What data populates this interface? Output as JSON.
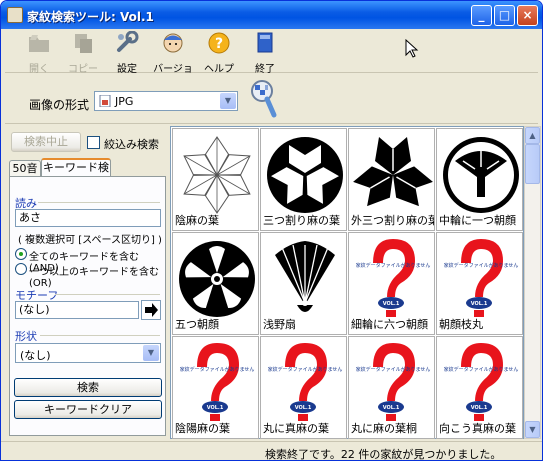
{
  "window": {
    "title": "家紋検索ツール: Vol.1",
    "controls": [
      "_",
      "□",
      "×"
    ]
  },
  "toolbar": [
    {
      "label": "開く",
      "icon": "folder-icon",
      "enabled": false
    },
    {
      "label": "コピー",
      "icon": "copy-icon",
      "enabled": false
    },
    {
      "label": "設定",
      "icon": "wrench-icon",
      "enabled": true
    },
    {
      "label": "バージョン",
      "icon": "person-icon",
      "enabled": true
    },
    {
      "label": "ヘルプ",
      "icon": "help-icon",
      "enabled": true
    },
    {
      "label": "終了",
      "icon": "book-exit-icon",
      "enabled": true
    }
  ],
  "format": {
    "label": "画像の形式",
    "value": "JPG"
  },
  "left": {
    "stop_button": "検索中止",
    "narrow_search_label": "絞込み検索",
    "narrow_search_checked": false,
    "tabs": [
      {
        "label": "50音",
        "active": false
      },
      {
        "label": "キーワード検索",
        "active": true
      }
    ],
    "reading": {
      "label": "読み",
      "value": "あさ",
      "hint": "( 複数選択可 [スペース区切り] )"
    },
    "match_options": [
      {
        "label": "全てのキーワードを含む(AND)",
        "selected": true
      },
      {
        "label": "一つ以上のキーワードを含む(OR)",
        "selected": false
      }
    ],
    "motif": {
      "label": "モチーフ",
      "value": "(なし)"
    },
    "shape": {
      "label": "形状",
      "value": "(なし)"
    },
    "search_button": "検索",
    "clear_button": "キーワードクリア"
  },
  "results": [
    {
      "name": "陰麻の葉",
      "kind": "asa-outline"
    },
    {
      "name": "三つ割り麻の葉",
      "kind": "mitsuwari"
    },
    {
      "name": "外三つ割り麻の葉",
      "kind": "sotomitsuwari"
    },
    {
      "name": "中輪に一つ朝顔",
      "kind": "asagao-ring"
    },
    {
      "name": "五つ朝顔",
      "kind": "itsutsu-asagao"
    },
    {
      "name": "浅野扇",
      "kind": "asano-ogi"
    },
    {
      "name": "細輪に六つ朝顔",
      "kind": "placeholder"
    },
    {
      "name": "朝顔枝丸",
      "kind": "placeholder"
    },
    {
      "name": "陰陽麻の葉",
      "kind": "placeholder"
    },
    {
      "name": "丸に真麻の葉",
      "kind": "placeholder"
    },
    {
      "name": "丸に麻の葉桐",
      "kind": "placeholder"
    },
    {
      "name": "向こう真麻の葉",
      "kind": "placeholder"
    }
  ],
  "placeholder": {
    "line1": "家紋データファイルがありません",
    "badge": "VOL.1"
  },
  "status": "検索終了です。22 件の家紋が見つかりました。",
  "colors": {
    "title_bar": "#0054e3",
    "placeholder_red": "#e8141c",
    "badge_blue": "#1a3a8f"
  }
}
